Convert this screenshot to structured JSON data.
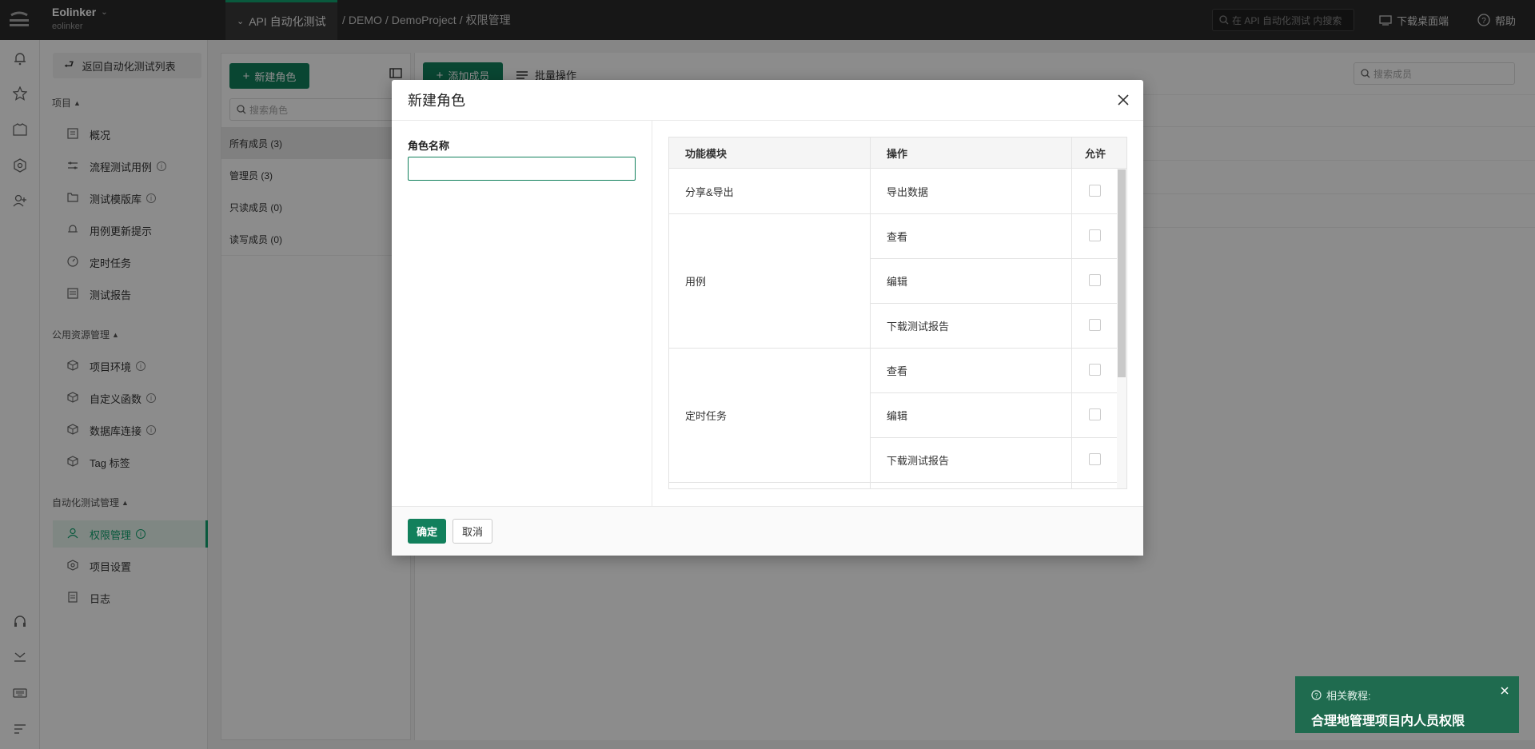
{
  "topbar": {
    "org_name": "Eolinker",
    "org_sub": "eolinker",
    "active_tab": "API 自动化测试",
    "breadcrumb": [
      "DEMO",
      "DemoProject",
      "权限管理"
    ],
    "search_placeholder": "在 API 自动化测试 内搜索",
    "download_label": "下载桌面端",
    "help_label": "帮助"
  },
  "rail": {
    "icons": [
      "bell-icon",
      "star-icon",
      "shirt-icon",
      "gear-icon",
      "add-user-icon",
      "headset-icon",
      "download-icon",
      "keyboard-icon",
      "menu-icon"
    ]
  },
  "nav": {
    "back_label": "返回自动化测试列表",
    "group_project": "项目",
    "group_public": "公用资源管理",
    "group_auto": "自动化测试管理",
    "items": [
      {
        "label": "概况",
        "icon": "overview-icon",
        "info": false
      },
      {
        "label": "流程测试用例",
        "icon": "flow-icon",
        "info": true
      },
      {
        "label": "测试模版库",
        "icon": "folder-icon",
        "info": true
      },
      {
        "label": "用例更新提示",
        "icon": "bell-icon",
        "info": false
      },
      {
        "label": "定时任务",
        "icon": "clock-icon",
        "info": false
      },
      {
        "label": "测试报告",
        "icon": "report-icon",
        "info": false
      },
      {
        "label": "项目环境",
        "icon": "cube-icon",
        "info": true
      },
      {
        "label": "自定义函数",
        "icon": "cube-icon",
        "info": true
      },
      {
        "label": "数据库连接",
        "icon": "cube-icon",
        "info": true
      },
      {
        "label": "Tag 标签",
        "icon": "cube-icon",
        "info": false
      },
      {
        "label": "权限管理",
        "icon": "user-icon",
        "info": true,
        "active": true
      },
      {
        "label": "项目设置",
        "icon": "gear-icon",
        "info": false
      },
      {
        "label": "日志",
        "icon": "log-icon",
        "info": false
      }
    ]
  },
  "roles": {
    "new_label": "新建角色",
    "search_placeholder": "搜索角色",
    "rows": [
      "所有成员 (3)",
      "管理员 (3)",
      "只读成员 (0)",
      "读写成员 (0)"
    ]
  },
  "members": {
    "add_label": "添加成员",
    "batch_label": "批量操作",
    "search_placeholder": "搜索成员"
  },
  "modal": {
    "title": "新建角色",
    "field_label": "角色名称",
    "field_value": "",
    "table": {
      "headers": [
        "功能模块",
        "操作",
        "允许"
      ],
      "modules": [
        {
          "name": "分享&导出",
          "ops": [
            "导出数据"
          ]
        },
        {
          "name": "用例",
          "ops": [
            "查看",
            "编辑",
            "下载测试报告"
          ]
        },
        {
          "name": "定时任务",
          "ops": [
            "查看",
            "编辑",
            "下载测试报告"
          ]
        }
      ]
    },
    "ok_label": "确定",
    "cancel_label": "取消"
  },
  "toast": {
    "sub_label": "相关教程:",
    "title": "合理地管理项目内人员权限"
  },
  "colors": {
    "brand": "#12805c",
    "accent": "#12a36f",
    "topbar": "#2b2b2b",
    "toast": "#1f6b4f"
  }
}
